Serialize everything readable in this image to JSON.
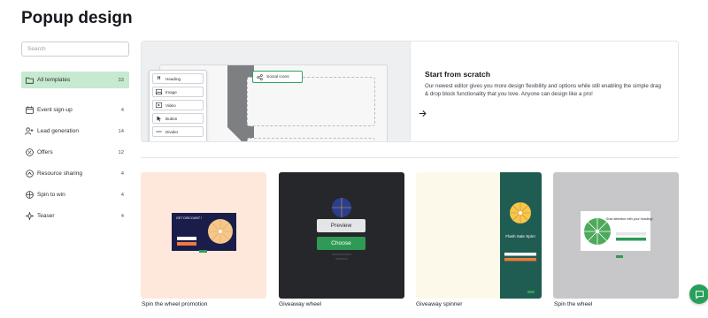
{
  "page": {
    "title": "Popup design"
  },
  "search": {
    "placeholder": "Search",
    "value": ""
  },
  "sidebar": {
    "items": [
      {
        "label": "All templates",
        "count": "33",
        "icon": "folder-icon",
        "active": true
      },
      {
        "label": "Event sign-up",
        "count": "4",
        "icon": "calendar-icon",
        "active": false
      },
      {
        "label": "Lead generation",
        "count": "14",
        "icon": "user-plus-icon",
        "active": false
      },
      {
        "label": "Offers",
        "count": "12",
        "icon": "percent-icon",
        "active": false
      },
      {
        "label": "Resource sharing",
        "count": "4",
        "icon": "share-icon",
        "active": false
      },
      {
        "label": "Spin to win",
        "count": "4",
        "icon": "spin-icon",
        "active": false
      },
      {
        "label": "Teaser",
        "count": "4",
        "icon": "sparkle-icon",
        "active": false
      }
    ]
  },
  "hero": {
    "title": "Start from scratch",
    "description": "Our newest editor gives you more design flexibility and options while still enabling the simple drag & drop block functionality that you love. Anyone can design like a pro!",
    "tools": [
      "Heading",
      "Image",
      "Video",
      "Button",
      "Divider"
    ],
    "chip": "Social icons"
  },
  "templates": [
    {
      "name": "Spin the wheel promotion",
      "background": "#fde8db"
    },
    {
      "name": "Giveaway wheel",
      "background": "#25272a",
      "preview_label": "Preview",
      "choose_label": "Choose"
    },
    {
      "name": "Giveaway spinner",
      "background": "#fdf9ea"
    },
    {
      "name": "Spin the wheel",
      "background": "#c7c7c9"
    }
  ],
  "mini_text": {
    "card1_title": "GET DISCOUNT !",
    "card3_title": "Flash Sale Spin!",
    "card4_title": "Grab attention with your heading!"
  },
  "colors": {
    "accent": "#2f9a55",
    "active_bg": "#c6e9d0"
  }
}
